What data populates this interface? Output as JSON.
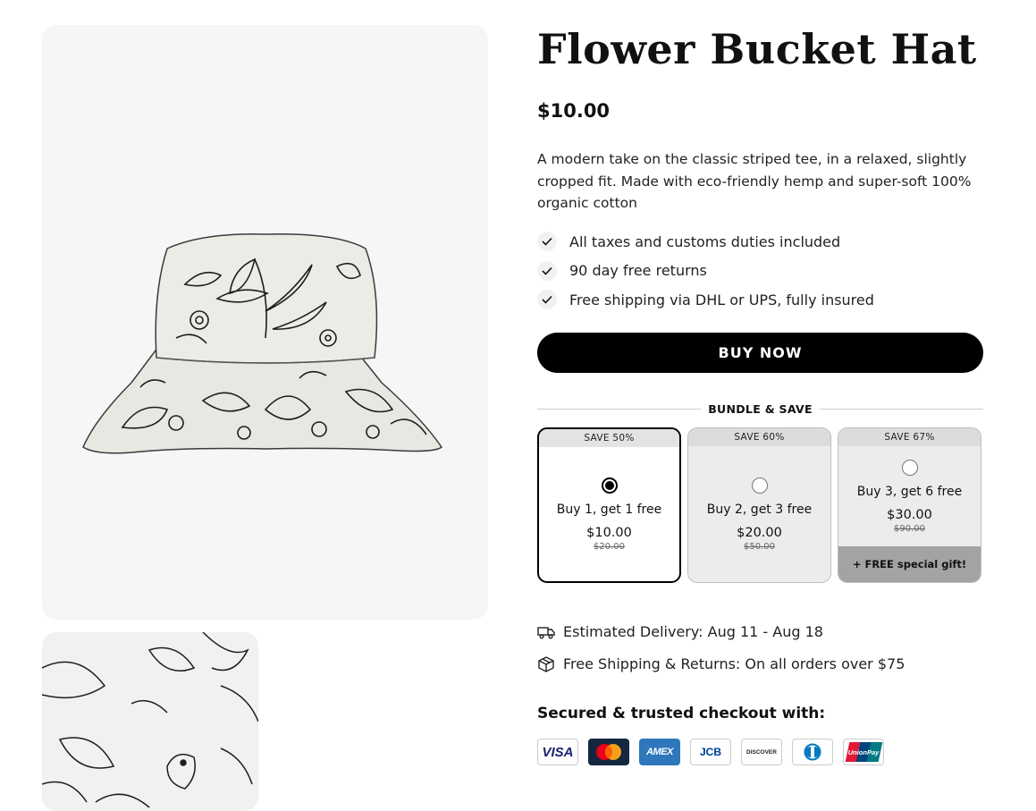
{
  "product": {
    "title": "Flower Bucket Hat",
    "price": "$10.00",
    "description": "A modern take on the classic striped tee, in a relaxed, slightly cropped fit. Made with eco-friendly hemp and super-soft 100% organic cotton",
    "features": [
      "All taxes and customs duties included",
      "90 day free returns",
      "Free shipping via DHL or UPS, fully insured"
    ],
    "buy_label": "BUY NOW"
  },
  "bundle": {
    "heading": "BUNDLE & SAVE",
    "options": [
      {
        "save": "SAVE 50%",
        "offer": "Buy 1, get 1 free",
        "price": "$10.00",
        "was": "$20.00",
        "selected": true
      },
      {
        "save": "SAVE 60%",
        "offer": "Buy 2, get 3 free",
        "price": "$20.00",
        "was": "$50.00",
        "selected": false
      },
      {
        "save": "SAVE 67%",
        "offer": "Buy 3, get 6 free",
        "price": "$30.00",
        "was": "$90.00",
        "selected": false,
        "gift": "+ FREE special gift!"
      }
    ]
  },
  "delivery": {
    "estimated": "Estimated Delivery: Aug 11 - Aug 18",
    "shipping": "Free Shipping & Returns: On all orders over $75",
    "icons": [
      "truck-icon",
      "package-icon"
    ]
  },
  "checkout": {
    "title": "Secured & trusted checkout with:",
    "payment_methods": [
      {
        "name": "visa-icon",
        "label": "VISA"
      },
      {
        "name": "mastercard-icon"
      },
      {
        "name": "amex-icon",
        "label": "AMEX"
      },
      {
        "name": "jcb-icon",
        "label": "JCB"
      },
      {
        "name": "discover-icon",
        "label": "DISCOVER"
      },
      {
        "name": "diners-club-icon"
      },
      {
        "name": "unionpay-icon",
        "label": "UnionPay"
      }
    ]
  },
  "colors": {
    "primary": "#000000",
    "card_bg": "#ececec",
    "gift_bg": "#a3a3a3",
    "image_bg": "#f6f6f6"
  }
}
